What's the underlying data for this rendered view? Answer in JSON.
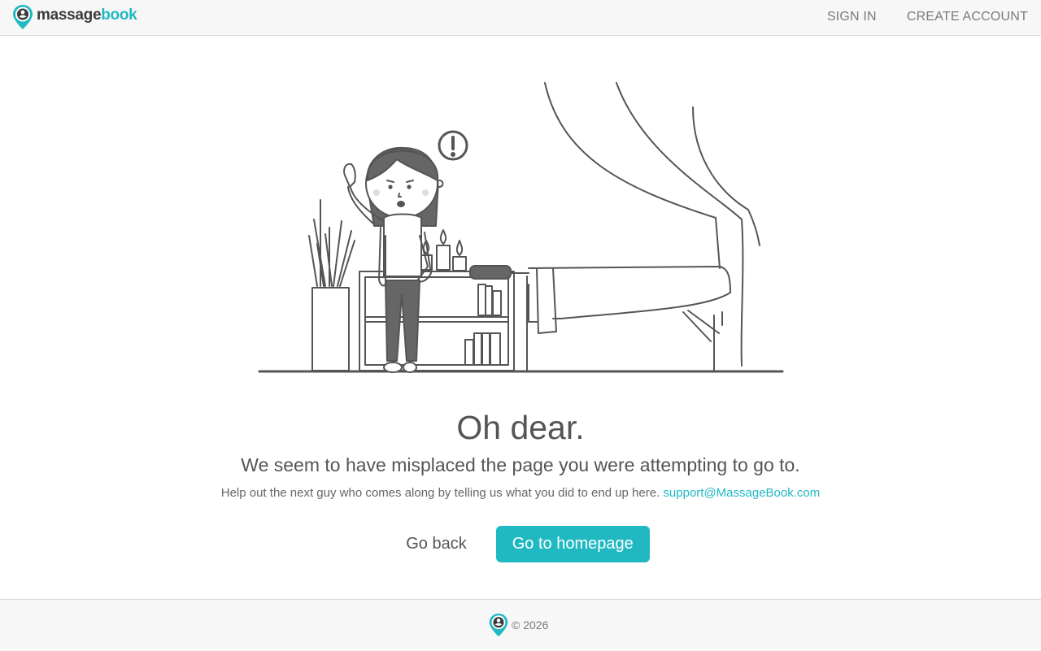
{
  "header": {
    "logo_part1": "massage",
    "logo_part2": "book",
    "nav": {
      "sign_in": "SIGN IN",
      "create_account": "CREATE ACCOUNT"
    }
  },
  "main": {
    "title": "Oh dear.",
    "subtitle": "We seem to have misplaced the page you were attempting to go to.",
    "help_text": "Help out the next guy who comes along by telling us what you did to end up here.",
    "support_email": "support@MassageBook.com",
    "go_back_label": "Go back",
    "go_home_label": "Go to homepage"
  },
  "footer": {
    "copyright": "© 2026"
  },
  "colors": {
    "accent": "#20b9c2",
    "text": "#555555",
    "line": "#555555"
  },
  "icons": [
    "logo-pin-icon",
    "exclamation-icon"
  ]
}
